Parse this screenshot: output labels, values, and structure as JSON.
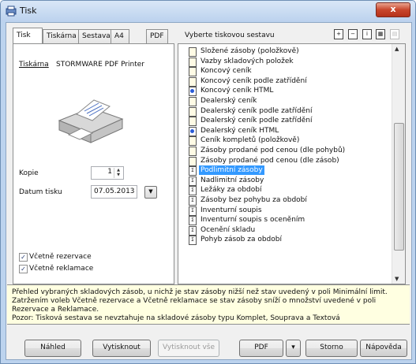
{
  "window": {
    "title": "Tisk",
    "close_label": "x"
  },
  "left_tabs": [
    {
      "label": "Tisk",
      "active": true
    },
    {
      "label": "Tiskárna",
      "active": false
    },
    {
      "label": "Sestava",
      "active": false
    },
    {
      "label": "A4",
      "active": false
    },
    {
      "label": "PDF",
      "active": false
    }
  ],
  "printer": {
    "label": "Tiskárna",
    "name": "STORMWARE PDF Printer"
  },
  "copies": {
    "label": "Kopie",
    "value": "1"
  },
  "print_date": {
    "label": "Datum tisku",
    "value": "07.05.2013"
  },
  "checkboxes": [
    {
      "label": "Včetně rezervace",
      "checked": true
    },
    {
      "label": "Včetně reklamace",
      "checked": true
    }
  ],
  "report_list": {
    "header": "Vyberte tiskovou sestavu",
    "toolbar_icons": [
      "expand-icon",
      "collapse-icon",
      "info-icon",
      "print-preview-icon",
      "grid-icon"
    ],
    "items": [
      {
        "label": "Složené zásoby (položkově)",
        "icon": "report-icon",
        "selected": false
      },
      {
        "label": "Vazby skladových položek",
        "icon": "report-icon",
        "selected": false
      },
      {
        "label": "Koncový ceník",
        "icon": "report-icon",
        "selected": false
      },
      {
        "label": "Koncový ceník podle zatřídění",
        "icon": "report-icon",
        "selected": false
      },
      {
        "label": "Koncový ceník HTML",
        "icon": "html-report-icon",
        "selected": false
      },
      {
        "label": "Dealerský ceník",
        "icon": "report-icon",
        "selected": false
      },
      {
        "label": "Dealerský ceník podle zatřídění",
        "icon": "report-icon",
        "selected": false
      },
      {
        "label": "Dealerský ceník podle zatřídění",
        "icon": "report-icon",
        "selected": false
      },
      {
        "label": "Dealerský ceník HTML",
        "icon": "html-report-icon",
        "selected": false
      },
      {
        "label": "Ceník kompletů (položkově)",
        "icon": "report-icon",
        "selected": false
      },
      {
        "label": "Zásoby prodané pod cenou (dle pohybů)",
        "icon": "report-icon",
        "selected": false
      },
      {
        "label": "Zásoby prodané pod cenou (dle zásob)",
        "icon": "report-icon",
        "selected": false
      },
      {
        "label": "Podlimitní zásoby",
        "icon": "bracket-report-icon",
        "selected": true
      },
      {
        "label": "Nadlimitní zásoby",
        "icon": "bracket-report-icon",
        "selected": false
      },
      {
        "label": "Ležáky za období",
        "icon": "bracket-report-icon",
        "selected": false
      },
      {
        "label": "Zásoby bez pohybu za období",
        "icon": "bracket-report-icon",
        "selected": false
      },
      {
        "label": "Inventurní soupis",
        "icon": "bracket-report-icon",
        "selected": false
      },
      {
        "label": "Inventurní soupis s oceněním",
        "icon": "bracket-report-icon",
        "selected": false
      },
      {
        "label": "Ocenění skladu",
        "icon": "bracket-report-icon",
        "selected": false
      },
      {
        "label": "Pohyb zásob za období",
        "icon": "bracket-report-icon",
        "selected": false
      }
    ]
  },
  "description": {
    "line1": "Přehled vybraných skladových zásob, u nichž je stav zásoby nižší než stav uvedený v poli Minimální limit.",
    "line2": "Zatržením voleb Včetně rezervace a Včetně reklamace se stav zásoby sníží o množství uvedené v poli Rezervace a Reklamace.",
    "line3": "Pozor: Tisková sestava se nevztahuje na skladové zásoby typu Komplet, Souprava a Textová"
  },
  "buttons": {
    "preview": "Náhled",
    "print": "Vytisknout",
    "print_all": "Vytisknout vše",
    "pdf": "PDF",
    "pdf_dropdown": "▾",
    "cancel": "Storno",
    "help": "Nápověda"
  }
}
